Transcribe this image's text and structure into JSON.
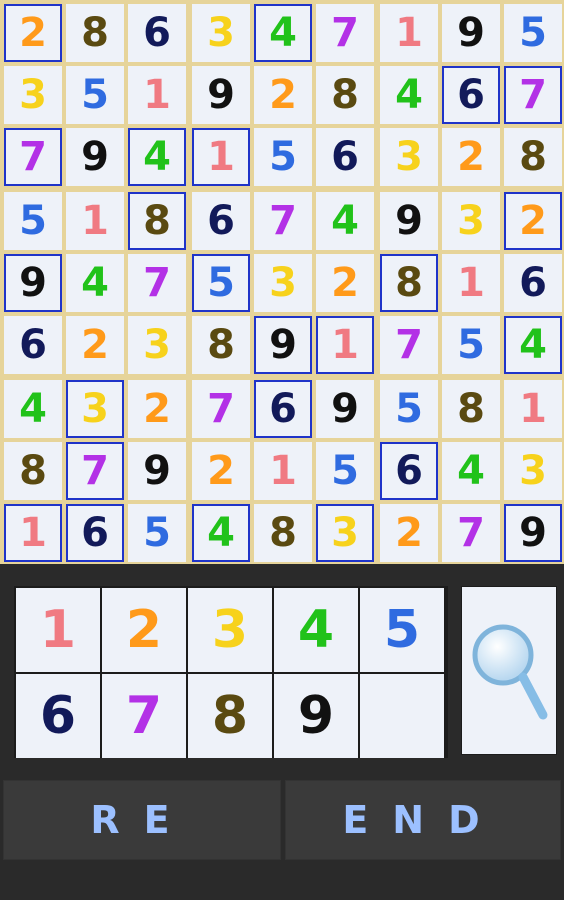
{
  "colors": {
    "1": "#f07a82",
    "2": "#ff9a1a",
    "3": "#f7d21c",
    "4": "#21c21a",
    "5": "#2f6be0",
    "6": "#121a5a",
    "7": "#b331e6",
    "8": "#5a4a11",
    "9": "#111111"
  },
  "grid": [
    [
      "2",
      "8",
      "6",
      "3",
      "4",
      "7",
      "1",
      "9",
      "5"
    ],
    [
      "3",
      "5",
      "1",
      "9",
      "2",
      "8",
      "4",
      "6",
      "7"
    ],
    [
      "7",
      "9",
      "4",
      "1",
      "5",
      "6",
      "3",
      "2",
      "8"
    ],
    [
      "5",
      "1",
      "8",
      "6",
      "7",
      "4",
      "9",
      "3",
      "2"
    ],
    [
      "9",
      "4",
      "7",
      "5",
      "3",
      "2",
      "8",
      "1",
      "6"
    ],
    [
      "6",
      "2",
      "3",
      "8",
      "9",
      "1",
      "7",
      "5",
      "4"
    ],
    [
      "4",
      "3",
      "2",
      "7",
      "6",
      "9",
      "5",
      "8",
      "1"
    ],
    [
      "8",
      "7",
      "9",
      "2",
      "1",
      "5",
      "6",
      "4",
      "3"
    ],
    [
      "1",
      "6",
      "5",
      "4",
      "8",
      "3",
      "2",
      "7",
      "9"
    ]
  ],
  "given": [
    [
      0,
      0
    ],
    [
      0,
      4
    ],
    [
      1,
      7
    ],
    [
      1,
      8
    ],
    [
      2,
      0
    ],
    [
      2,
      2
    ],
    [
      2,
      3
    ],
    [
      3,
      2
    ],
    [
      3,
      8
    ],
    [
      4,
      0
    ],
    [
      4,
      3
    ],
    [
      4,
      6
    ],
    [
      5,
      4
    ],
    [
      5,
      5
    ],
    [
      5,
      8
    ],
    [
      6,
      1
    ],
    [
      6,
      4
    ],
    [
      7,
      1
    ],
    [
      7,
      6
    ],
    [
      8,
      0
    ],
    [
      8,
      1
    ],
    [
      8,
      3
    ],
    [
      8,
      5
    ],
    [
      8,
      8
    ]
  ],
  "keypad": [
    "1",
    "2",
    "3",
    "4",
    "5",
    "6",
    "7",
    "8",
    "9",
    ""
  ],
  "hint": {
    "icon": "magnifier-icon"
  },
  "buttons": {
    "restart_label": "RE",
    "end_label": "END"
  }
}
